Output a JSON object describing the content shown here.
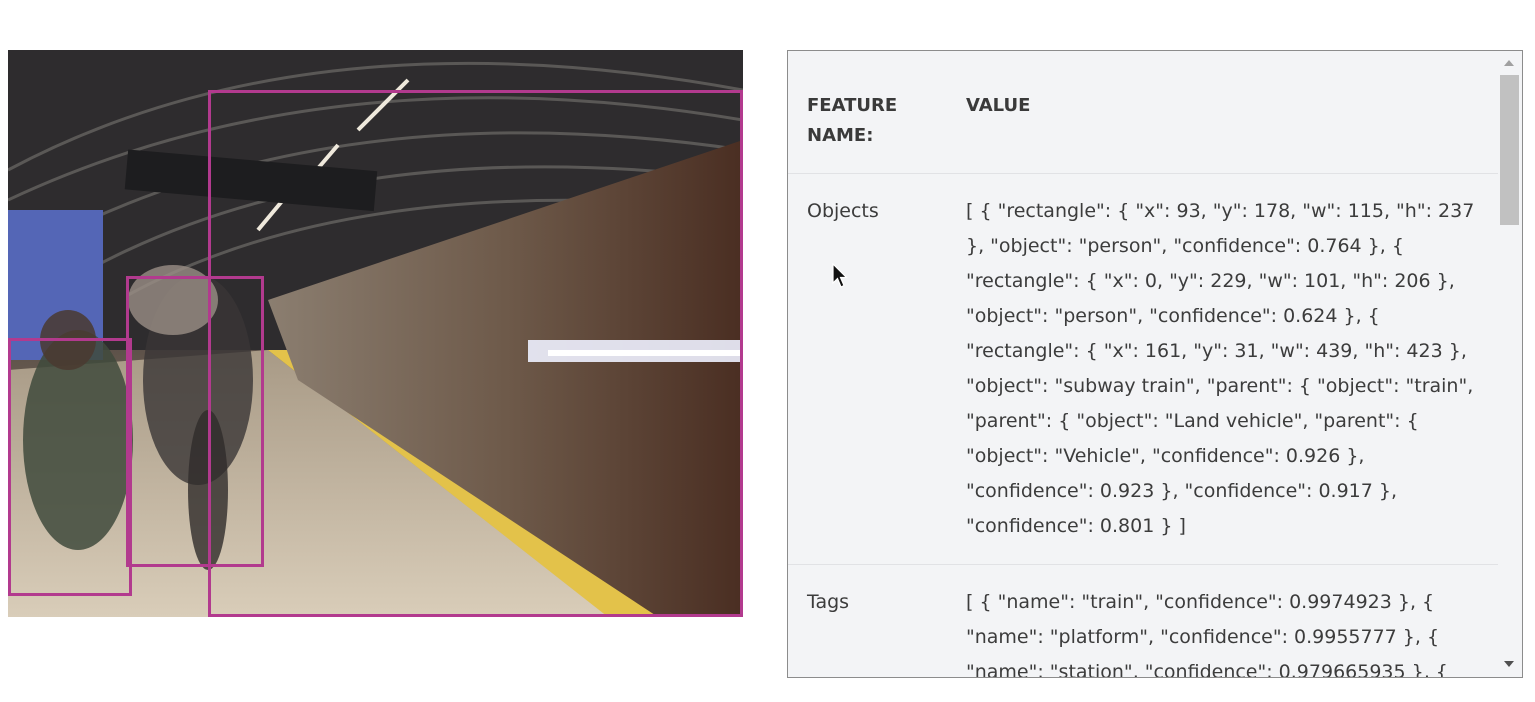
{
  "image": {
    "alt": "subway station platform with blurred train and people",
    "bbox_color": "#b23a8e",
    "bbox_color_name": "magenta"
  },
  "table": {
    "headers": {
      "feature": "FEATURE NAME:",
      "value": "VALUE"
    },
    "rows": [
      {
        "feature": "Objects",
        "value": "[ { \"rectangle\": { \"x\": 93, \"y\": 178, \"w\": 115, \"h\": 237 }, \"object\": \"person\", \"confidence\": 0.764 }, { \"rectangle\": { \"x\": 0, \"y\": 229, \"w\": 101, \"h\": 206 }, \"object\": \"person\", \"confidence\": 0.624 }, { \"rectangle\": { \"x\": 161, \"y\": 31, \"w\": 439, \"h\": 423 }, \"object\": \"subway train\", \"parent\": { \"object\": \"train\", \"parent\": { \"object\": \"Land vehicle\", \"parent\": { \"object\": \"Vehicle\", \"confidence\": 0.926 }, \"confidence\": 0.923 }, \"confidence\": 0.917 }, \"confidence\": 0.801 } ]"
      },
      {
        "feature": "Tags",
        "value": "[ { \"name\": \"train\", \"confidence\": 0.9974923 }, { \"name\": \"platform\", \"confidence\": 0.9955777 }, { \"name\": \"station\", \"confidence\": 0.979665935 }, {"
      }
    ]
  },
  "colors": {
    "panel_bg": "#f3f4f6",
    "panel_border": "#8c8c8c",
    "text": "#3c3c3c"
  }
}
